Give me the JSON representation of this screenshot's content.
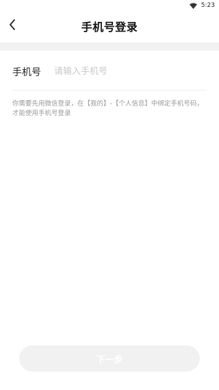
{
  "status_bar": {
    "time": "5:23",
    "wifi_icon": "wifi-icon"
  },
  "header": {
    "back_icon": "chevron-left-icon",
    "title": "手机号登录"
  },
  "form": {
    "phone_label": "手机号",
    "phone_placeholder": "请输入手机号",
    "phone_value": ""
  },
  "hint": "你需要先用微信登录，在【我的】-【个人信息】中绑定手机号码，才能使用手机号登录",
  "footer": {
    "next_label": "下一步"
  }
}
